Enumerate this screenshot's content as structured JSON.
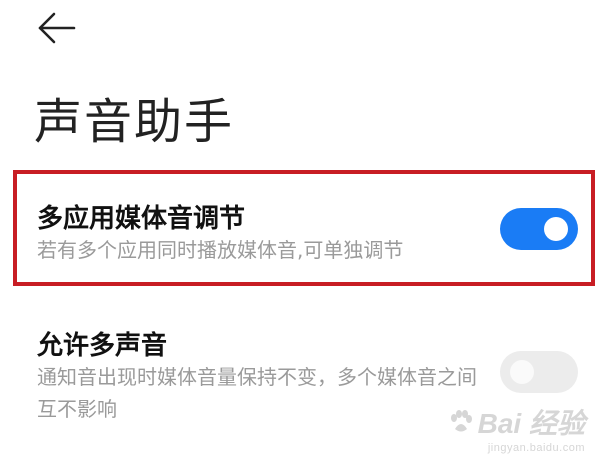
{
  "page": {
    "title": "声音助手"
  },
  "settings": [
    {
      "title": "多应用媒体音调节",
      "description": "若有多个应用同时播放媒体音,可单独调节",
      "enabled": true
    },
    {
      "title": "允许多声音",
      "description": "通知音出现时媒体音量保持不变，多个媒体音之间互不影响",
      "enabled": false
    }
  ],
  "icons": {
    "back": "arrow-left-icon",
    "watermark": "baidu-paw-icon"
  },
  "colors": {
    "accent": "#1a7cf5",
    "highlight_border": "#c81d24",
    "toggle_off": "#ececec",
    "description_text": "#9a9a9a"
  },
  "watermark": {
    "brand": "Bai 经验",
    "url": "jingyan.baidu.com"
  }
}
